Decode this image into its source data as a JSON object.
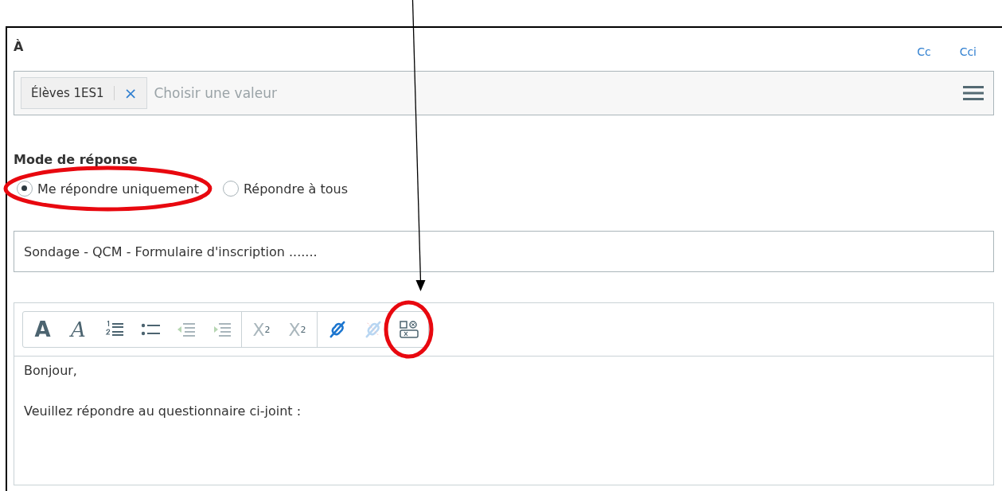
{
  "recipients": {
    "label": "À",
    "links": [
      {
        "label": "Cc"
      },
      {
        "label": "Cci"
      }
    ],
    "chips": [
      {
        "label": "Élèves 1ES1",
        "remove": "×"
      }
    ],
    "placeholder": "Choisir une valeur"
  },
  "reply_mode": {
    "label": "Mode de réponse",
    "options": [
      {
        "label": "Me répondre uniquement",
        "selected": true,
        "highlighted": true
      },
      {
        "label": "Répondre à tous",
        "selected": false,
        "highlighted": false
      }
    ]
  },
  "subject": {
    "value": "Sondage - QCM - Formulaire d'inscription ......."
  },
  "editor": {
    "toolbar": [
      [
        {
          "kind": "bold",
          "text": "A",
          "disabled": false
        },
        {
          "kind": "italic",
          "text": "A",
          "disabled": false
        },
        {
          "kind": "ordered-list",
          "disabled": false
        },
        {
          "kind": "bullet-list",
          "disabled": false
        },
        {
          "kind": "outdent",
          "disabled": true
        },
        {
          "kind": "indent",
          "disabled": true
        }
      ],
      [
        {
          "kind": "subscript",
          "text": "X",
          "mark": "2",
          "disabled": true
        },
        {
          "kind": "superscript",
          "text": "X",
          "mark": "2",
          "disabled": true
        }
      ],
      [
        {
          "kind": "link",
          "disabled": false
        },
        {
          "kind": "unlink",
          "disabled": true
        },
        {
          "kind": "field",
          "disabled": false,
          "highlighted": true,
          "pointed": true
        }
      ]
    ],
    "paragraphs": [
      "Bonjour,",
      "Veuillez répondre au questionnaire ci-joint :"
    ]
  }
}
